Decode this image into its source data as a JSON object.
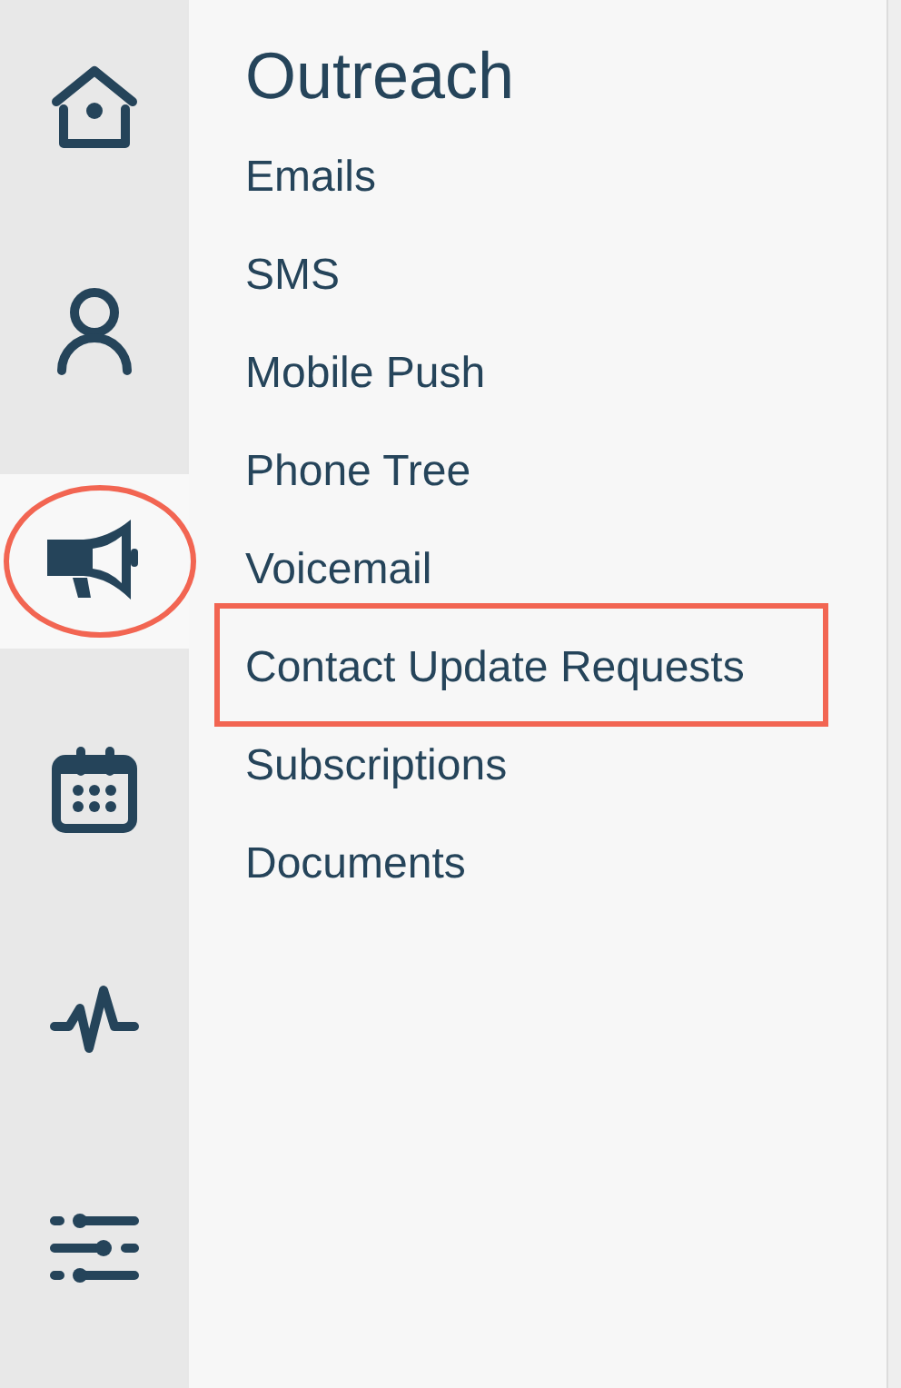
{
  "rail": {
    "items": [
      {
        "kind": "home",
        "selected": false,
        "circled": false
      },
      {
        "kind": "person",
        "selected": false,
        "circled": false
      },
      {
        "kind": "megaphone",
        "selected": true,
        "circled": true
      },
      {
        "kind": "calendar",
        "selected": false,
        "circled": false
      },
      {
        "kind": "pulse",
        "selected": false,
        "circled": false
      },
      {
        "kind": "sliders",
        "selected": false,
        "circled": false
      }
    ]
  },
  "menu": {
    "title": "Outreach",
    "items": [
      {
        "label": "Emails",
        "boxed": false
      },
      {
        "label": "SMS",
        "boxed": false
      },
      {
        "label": "Mobile Push",
        "boxed": false
      },
      {
        "label": "Phone Tree",
        "boxed": false
      },
      {
        "label": "Voicemail",
        "boxed": false
      },
      {
        "label": "Contact Update Requests",
        "boxed": true
      },
      {
        "label": "Subscriptions",
        "boxed": false
      },
      {
        "label": "Documents",
        "boxed": false
      }
    ]
  }
}
